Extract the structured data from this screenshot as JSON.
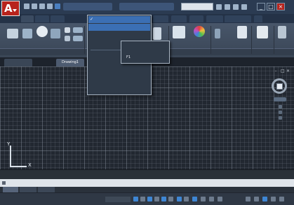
{
  "app": {
    "logo_letter": "A"
  },
  "window_controls": {
    "minimize": "_",
    "restore": "□",
    "close": "×"
  },
  "icons": {
    "app_menu": "autocad-logo-icon",
    "search": "search-icon",
    "workspace": "gear-icon",
    "viewcube": "viewcube-icon",
    "navigation": "navigation-bar-icon",
    "ucs": "ucs-axes-icon"
  },
  "colors": {
    "accent": "#3b6fb4",
    "logo": "#b8231c",
    "canvas": "#222831",
    "ribbon": "#48566a"
  },
  "document_tabs": {
    "items": [
      {
        "label": ""
      },
      {
        "label": "Drawing1"
      }
    ],
    "new_tab": "+"
  },
  "viewport": {
    "label": "",
    "controls": {
      "minimize": "-",
      "maximize": "□",
      "close": "×"
    },
    "wcs": ""
  },
  "ucs": {
    "x_label": "X",
    "y_label": "Y"
  },
  "command_line": {
    "history": "",
    "input_placeholder": ""
  },
  "layout_tabs": [
    "",
    "",
    ""
  ],
  "status": {
    "coords": "",
    "scale": ""
  },
  "workspace_menu": {
    "items": [
      {
        "label": "",
        "selected": true,
        "checked": true
      },
      {
        "label": "",
        "selected": true
      },
      {
        "label": ""
      },
      {
        "label": "",
        "has_submenu": true
      },
      {
        "label": ""
      },
      {
        "label": ""
      },
      {
        "label": ""
      }
    ],
    "submenu": [
      {
        "label": ""
      },
      {
        "label": "F1"
      }
    ]
  }
}
